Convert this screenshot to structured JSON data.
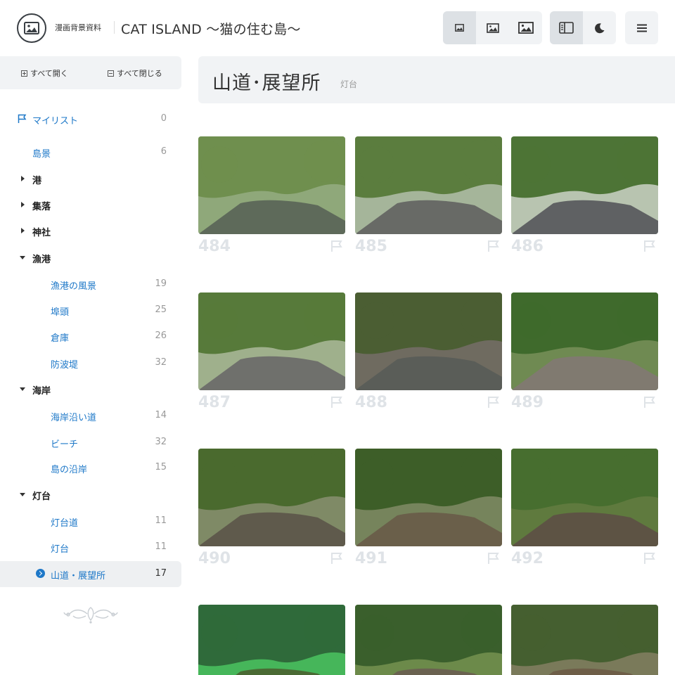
{
  "header": {
    "brand": "漫画背景資料",
    "site_title": "CAT ISLAND 〜猫の住む島〜",
    "icons": [
      "image-small-icon",
      "image-medium-icon",
      "image-large-icon",
      "sidebar-icon",
      "moon-icon",
      "menu-icon"
    ]
  },
  "sidebar": {
    "expand_all": "すべて開く",
    "collapse_all": "すべて閉じる",
    "mylist": {
      "label": "マイリスト",
      "count": "0"
    },
    "items": [
      {
        "label": "島景",
        "count": "6"
      },
      {
        "label": "港"
      },
      {
        "label": "集落"
      },
      {
        "label": "神社"
      },
      {
        "label": "漁港"
      },
      {
        "label": "漁港の風景",
        "count": "19"
      },
      {
        "label": "埠頭",
        "count": "25"
      },
      {
        "label": "倉庫",
        "count": "26"
      },
      {
        "label": "防波堤",
        "count": "32"
      },
      {
        "label": "海岸"
      },
      {
        "label": "海岸沿い道",
        "count": "14"
      },
      {
        "label": "ビーチ",
        "count": "32"
      },
      {
        "label": "島の沿岸",
        "count": "15"
      },
      {
        "label": "灯台"
      },
      {
        "label": "灯台道",
        "count": "11"
      },
      {
        "label": "灯台",
        "count": "11"
      },
      {
        "label": "山道・展望所",
        "count": "17"
      }
    ]
  },
  "main": {
    "title": "山道･展望所",
    "subtitle": "灯台",
    "cards": [
      {
        "num": "484"
      },
      {
        "num": "485"
      },
      {
        "num": "486"
      },
      {
        "num": "487"
      },
      {
        "num": "488"
      },
      {
        "num": "489"
      },
      {
        "num": "490"
      },
      {
        "num": "491"
      },
      {
        "num": "492"
      },
      {
        "num": ""
      },
      {
        "num": ""
      },
      {
        "num": ""
      }
    ]
  },
  "colors": {
    "accent": "#1e78c8",
    "panel": "#f1f3f5",
    "muted": "#999999"
  }
}
